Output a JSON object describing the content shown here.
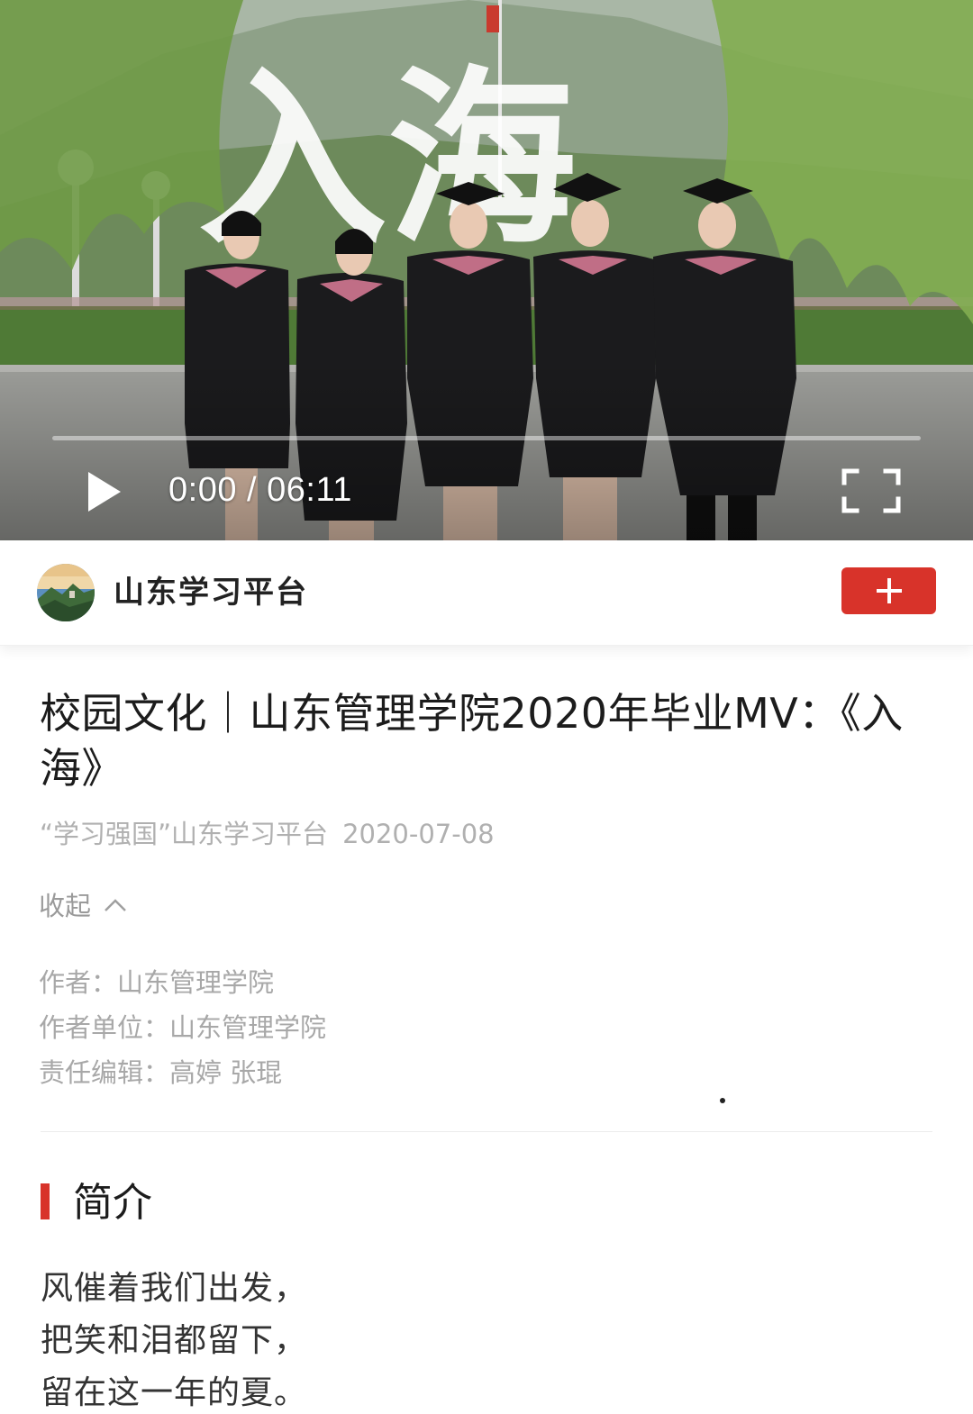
{
  "video": {
    "overlay_title": "入海",
    "current_time": "0:00",
    "time_separator": "/",
    "duration": "06:11",
    "progress": 0.0
  },
  "channel": {
    "name": "山东学习平台",
    "follow_icon": "plus-icon",
    "accent_color": "#d8332a"
  },
  "article": {
    "title": "校园文化｜山东管理学院2020年毕业MV：《入海》",
    "source": "“学习强国”山东学习平台",
    "date": "2020-07-08",
    "collapse_label": "收起",
    "credits": [
      {
        "label": "作者：",
        "value": "山东管理学院"
      },
      {
        "label": "作者单位：",
        "value": "山东管理学院"
      },
      {
        "label": "责任编辑：",
        "value": "高婷 张琨"
      }
    ]
  },
  "intro": {
    "heading": "简介",
    "lines": [
      "风催着我们出发，",
      "把笑和泪都留下，",
      "留在这一年的夏。"
    ]
  }
}
